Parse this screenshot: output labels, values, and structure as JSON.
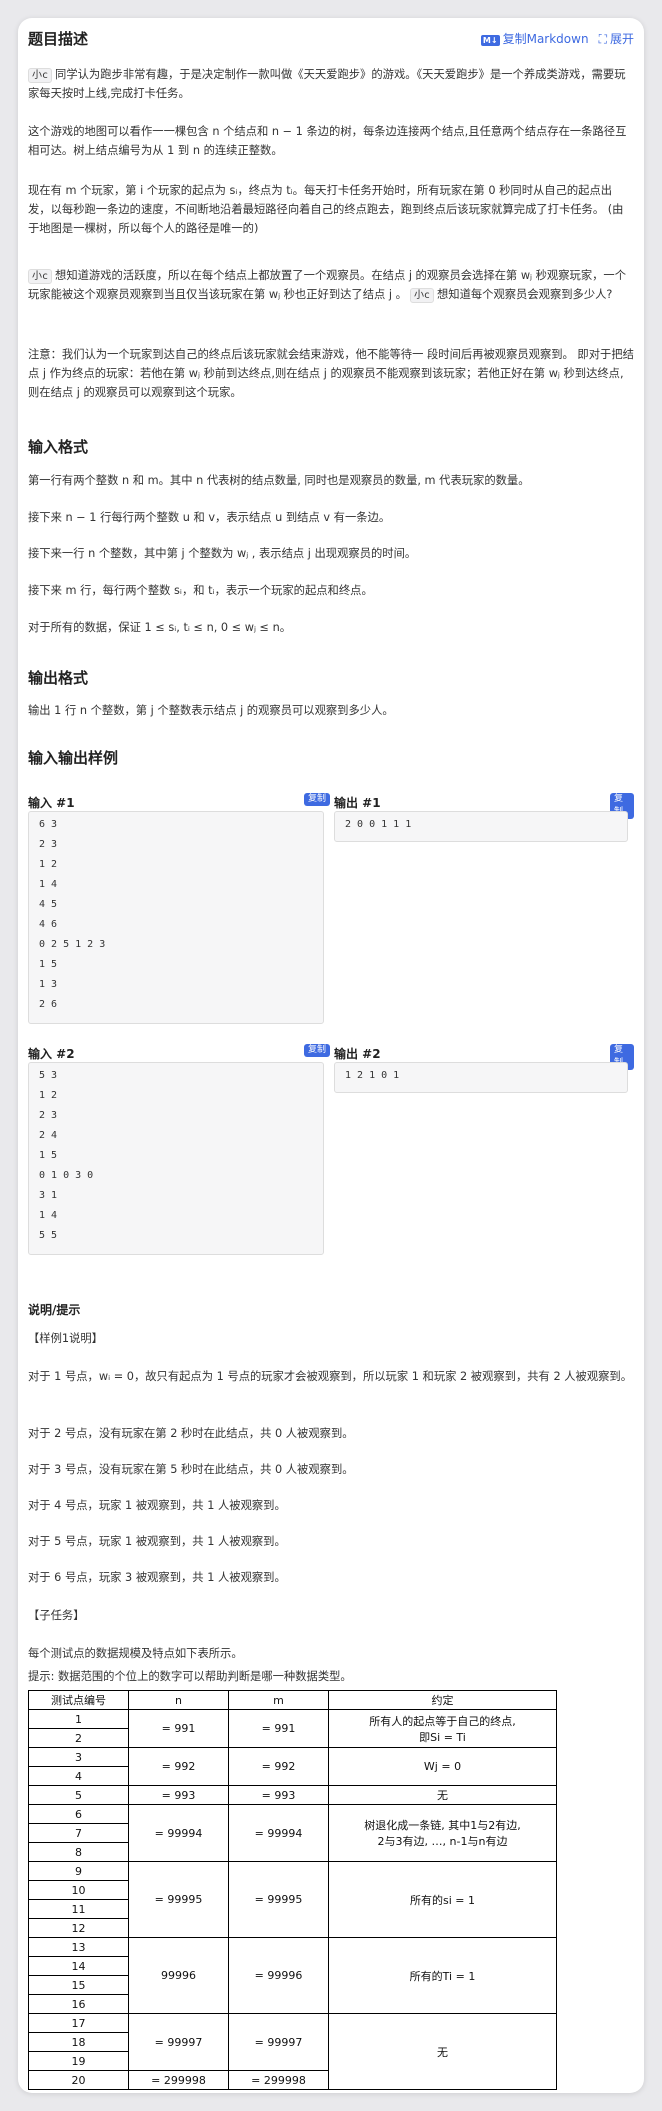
{
  "header": {
    "title": "题目描述",
    "copy_markdown": "复制Markdown",
    "expand": "展开",
    "md_badge": "M↓"
  },
  "desc": {
    "p1_tag": "小c",
    "p1": "同学认为跑步非常有趣，于是决定制作一款叫做《天天爱跑步》的游戏。《天天爱跑步》是一个养成类游戏，需要玩家每天按时上线,完成打卡任务。",
    "p2": "这个游戏的地图可以看作一一棵包含 n 个结点和 n − 1 条边的树，每条边连接两个结点,且任意两个结点存在一条路径互相可达。树上结点编号为从 1 到 n 的连续正整数。",
    "p3": "现在有 m 个玩家，第 i 个玩家的起点为 sᵢ，终点为 tᵢ。每天打卡任务开始时，所有玩家在第 0 秒同时从自己的起点出发，以每秒跑一条边的速度，不间断地沿着最短路径向着自己的终点跑去，跑到终点后该玩家就算完成了打卡任务。 (由于地图是一棵树，所以每个人的路径是唯一的)",
    "p4_tag": "小c",
    "p4a": "想知道游戏的活跃度，所以在每个结点上都放置了一个观察员。在结点 j 的观察员会选择在第 wⱼ 秒观察玩家，一个玩家能被这个观察员观察到当且仅当该玩家在第 wⱼ 秒也正好到达了结点 j 。",
    "p4_tag2": "小c",
    "p4b": "想知道每个观察员会观察到多少人?",
    "p5": "注意：我们认为一个玩家到达自己的终点后该玩家就会结束游戏，他不能等待一 段时间后再被观察员观察到。 即对于把结点 j 作为终点的玩家：若他在第 wⱼ 秒前到达终点,则在结点 j 的观察员不能观察到该玩家；若他正好在第 wⱼ 秒到达终点,则在结点 j 的观察员可以观察到这个玩家。"
  },
  "input_format": {
    "heading": "输入格式",
    "l1": "第一行有两个整数 n 和 m。其中 n 代表树的结点数量, 同时也是观察员的数量, m 代表玩家的数量。",
    "l2": "接下来 n − 1 行每行两个整数 u 和 v，表示结点 u 到结点 v 有一条边。",
    "l3": "接下来一行 n 个整数，其中第 j 个整数为 wⱼ , 表示结点 j 出现观察员的时间。",
    "l4": "接下来 m 行，每行两个整数 sᵢ，和 tᵢ，表示一个玩家的起点和终点。",
    "l5": "对于所有的数据，保证 1 ≤ sᵢ, tᵢ ≤ n, 0 ≤ wⱼ ≤ n。"
  },
  "output_format": {
    "heading": "输出格式",
    "l1": "输出 1 行 n 个整数，第 j 个整数表示结点 j 的观察员可以观察到多少人。"
  },
  "samples": {
    "heading": "输入输出样例",
    "copy": "复制",
    "in1_label": "输入 #1",
    "out1_label": "输出 #1",
    "in2_label": "输入 #2",
    "out2_label": "输出 #2",
    "in1": [
      "6 3",
      "2 3",
      "1 2",
      "1 4",
      "4 5",
      "4 6",
      "0 2 5 1 2 3",
      "1 5",
      "1 3",
      "2 6"
    ],
    "out1": [
      "2 0 0 1 1 1"
    ],
    "in2": [
      "5 3",
      "1 2",
      "2 3",
      "2 4",
      "1 5",
      "0 1 0 3 0",
      "3 1",
      "1 4",
      "5 5"
    ],
    "out2": [
      "1 2 1 0 1"
    ]
  },
  "hint": {
    "heading": "说明/提示",
    "ex_title": "【样例1说明】",
    "e1": "对于 1 号点，wᵢ = 0，故只有起点为 1 号点的玩家才会被观察到，所以玩家 1 和玩家 2 被观察到，共有 2 人被观察到。",
    "e2": "对于 2 号点，没有玩家在第 2 秒时在此结点，共 0 人被观察到。",
    "e3": "对于 3 号点，没有玩家在第 5 秒时在此结点，共 0 人被观察到。",
    "e4": "对于 4 号点，玩家 1 被观察到，共 1 人被观察到。",
    "e5": "对于 5 号点，玩家 1 被观察到，共 1 人被观察到。",
    "e6": "对于 6 号点，玩家 3 被观察到，共 1 人被观察到。",
    "sub_title": "【子任务】",
    "sub1": "每个测试点的数据规模及特点如下表所示。",
    "sub2": "提示: 数据范围的个位上的数字可以帮助判断是哪一种数据类型。"
  },
  "table": {
    "h": [
      "测试点编号",
      "n",
      "m",
      "约定"
    ],
    "ids": [
      "1",
      "2",
      "3",
      "4",
      "5",
      "6",
      "7",
      "8",
      "9",
      "10",
      "11",
      "12",
      "13",
      "14",
      "15",
      "16",
      "17",
      "18",
      "19",
      "20"
    ],
    "n": [
      "= 991",
      "= 992",
      "= 993",
      "= 99994",
      "= 99995",
      "99996",
      "= 99997",
      "= 299998"
    ],
    "m": [
      "= 991",
      "= 992",
      "= 993",
      "= 99994",
      "= 99995",
      "= 99996",
      "= 99997",
      "= 299998"
    ],
    "c1a": "所有人的起点等于自己的终点,",
    "c1b": "即Si = Ti",
    "c2": "Wj = 0",
    "c3": "无",
    "c4a": "树退化成一条链, 其中1与2有边,",
    "c4b": "2与3有边, …, n-1与n有边",
    "c5": "所有的si = 1",
    "c6": "所有的Ti = 1",
    "c7": "无"
  }
}
